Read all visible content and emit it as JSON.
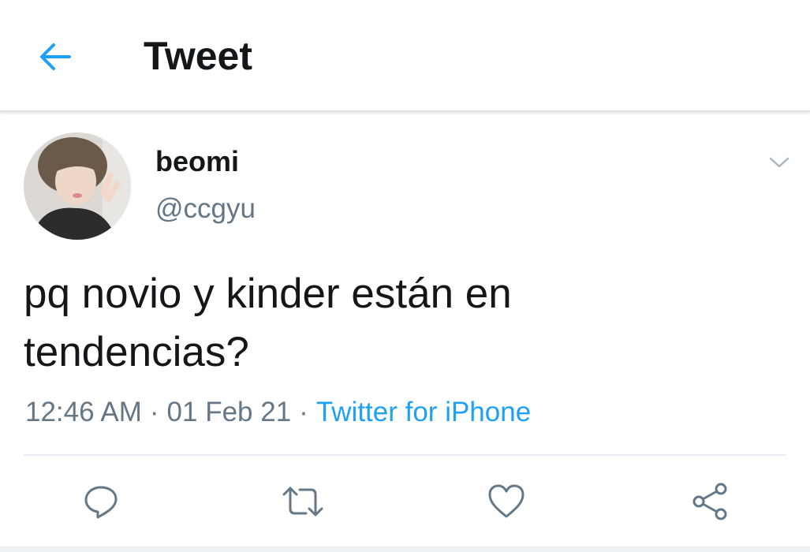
{
  "header": {
    "title": "Tweet",
    "back_icon": "arrow-left-icon"
  },
  "tweet": {
    "display_name": "beomi",
    "handle": "@ccgyu",
    "text_line1": "pq novio y kinder están en",
    "text_line2": "tendencias?",
    "time": "12:46 AM",
    "separator": "·",
    "date": "01 Feb 21",
    "source": "Twitter for iPhone"
  },
  "actions": {
    "reply_icon": "reply-icon",
    "retweet_icon": "retweet-icon",
    "like_icon": "heart-icon",
    "share_icon": "share-icon"
  },
  "colors": {
    "accent": "#1da1f2",
    "text_primary": "#14171a",
    "text_secondary": "#657786",
    "icon_gray": "#657786"
  }
}
